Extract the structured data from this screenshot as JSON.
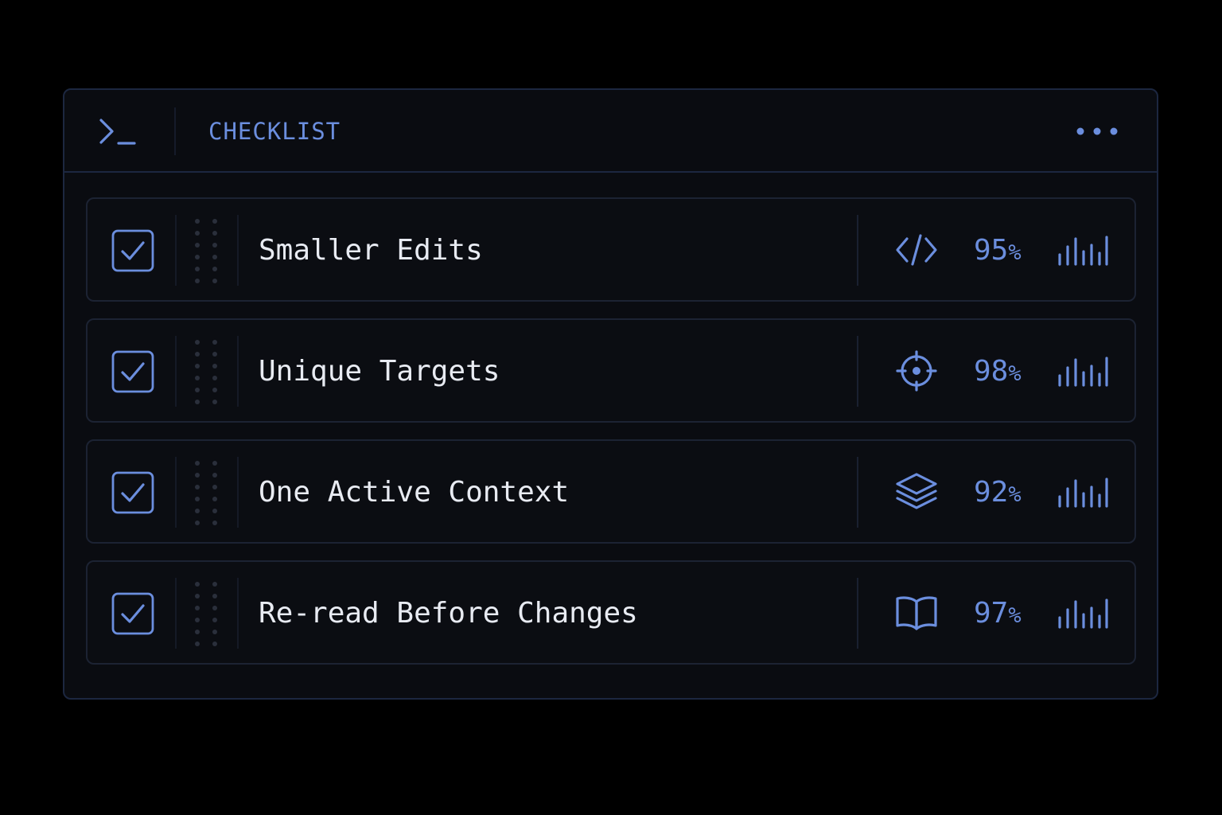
{
  "header": {
    "title": "CHECKLIST",
    "left_icon": "terminal-prompt-icon",
    "right_icon": "more-horizontal-icon"
  },
  "colors": {
    "background": "#000000",
    "panel": "#0a0c11",
    "accent": "#6b8ede",
    "text": "#e8ebf2",
    "border": "#1c2740"
  },
  "items": [
    {
      "label": "Smaller Edits",
      "checked": true,
      "icon": "code-icon",
      "percent": "95",
      "unit": "%",
      "meter": "signal-bars-icon"
    },
    {
      "label": "Unique Targets",
      "checked": true,
      "icon": "crosshair-icon",
      "percent": "98",
      "unit": "%",
      "meter": "signal-bars-icon"
    },
    {
      "label": "One Active Context",
      "checked": true,
      "icon": "layers-icon",
      "percent": "92",
      "unit": "%",
      "meter": "signal-bars-icon"
    },
    {
      "label": "Re-read Before Changes",
      "checked": true,
      "icon": "book-open-icon",
      "percent": "97",
      "unit": "%",
      "meter": "signal-bars-icon"
    }
  ]
}
